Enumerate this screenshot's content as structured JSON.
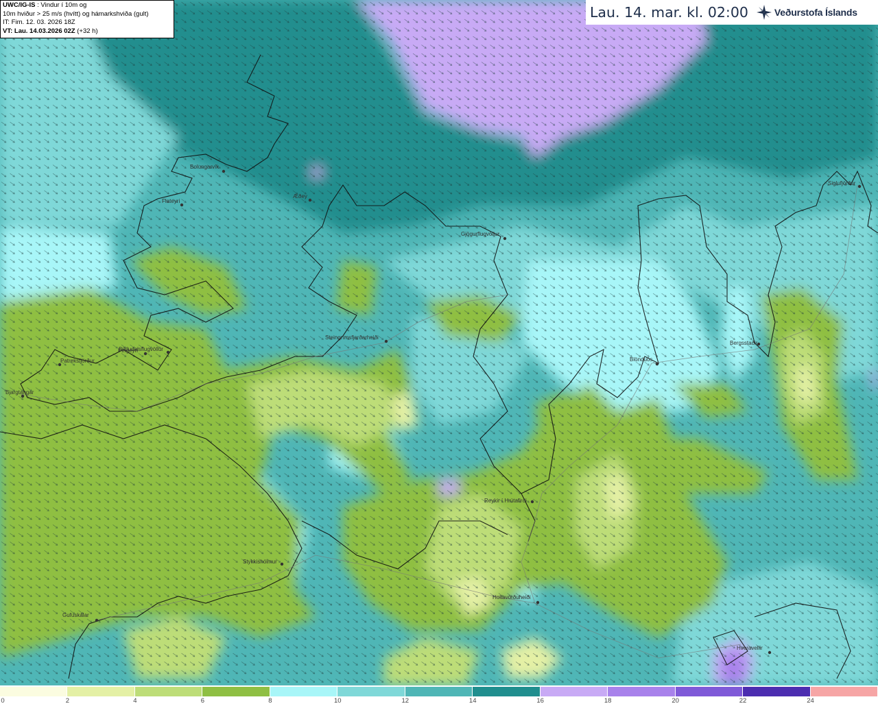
{
  "info": {
    "line1_bold": "UWC/IG-IS",
    "line1_rest": " : Vindur í 10m og",
    "line2": "10m hviður > 25 m/s (hvítt) og hámarkshviða (gult)",
    "line3": "IT: Fim. 12. 03. 2026 18Z",
    "line4_bold": "VT: Lau. 14.03.2026 02Z",
    "line4_rest": " (+32 h)"
  },
  "time_label": "Lau. 14. mar. kl. 02:00",
  "brand": {
    "name": "Veðurstofa Íslands",
    "icon": "vedurstofa-logo-icon"
  },
  "places": [
    {
      "name": "Bolungarvík"
    },
    {
      "name": "Flateyri"
    },
    {
      "name": "Æðey"
    },
    {
      "name": "Gjögurflugvöllur"
    },
    {
      "name": "Siglufjörður"
    },
    {
      "name": "Steingrímsfjarðarheiði"
    },
    {
      "name": "Þingeyri"
    },
    {
      "name": "Patreksfjörður"
    },
    {
      "name": "Bíldudalsflugvöllur"
    },
    {
      "name": "Bjargtangar"
    },
    {
      "name": "Blönduós"
    },
    {
      "name": "Bergsstaðir"
    },
    {
      "name": "Reykir í Hrútafirði"
    },
    {
      "name": "Stykkishólmur"
    },
    {
      "name": "Holtavörðuheiði"
    },
    {
      "name": "Gufuskálar"
    },
    {
      "name": "Hveravellir"
    }
  ],
  "legend": {
    "unit": "m/s",
    "colors": [
      "#fbfce0",
      "#e4f0a5",
      "#bddd78",
      "#8fbf43",
      "#a8f6f8",
      "#7fd8d8",
      "#4fb6b6",
      "#208e8e",
      "#c8aaf5",
      "#a882eb",
      "#7f5ad8",
      "#4c2db0",
      "#f6a5a5"
    ],
    "ticks": [
      "0",
      "2",
      "4",
      "6",
      "8",
      "10",
      "12",
      "14",
      "16",
      "18",
      "20",
      "22",
      "24"
    ]
  }
}
